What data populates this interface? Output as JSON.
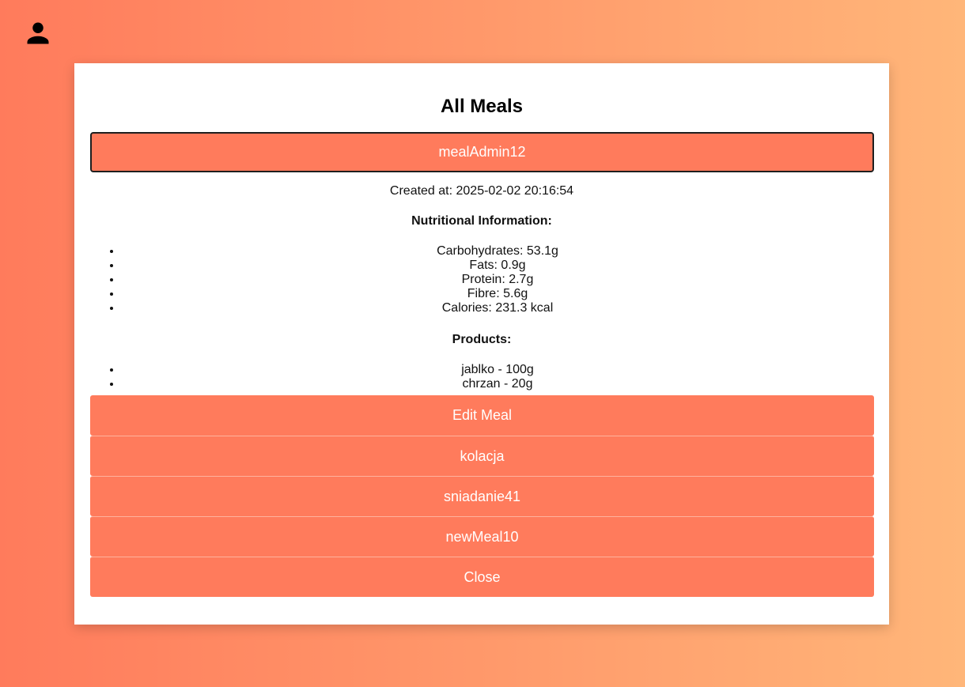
{
  "header": {
    "profile_icon": "user-icon"
  },
  "modal": {
    "title": "All Meals",
    "selected_meal": {
      "name": "mealAdmin12",
      "created_at": "Created at: 2025-02-02 20:16:54",
      "nutrition_heading": "Nutritional Information:",
      "nutrition": [
        "Carbohydrates: 53.1g",
        "Fats: 0.9g",
        "Protein: 2.7g",
        "Fibre: 5.6g",
        "Calories: 231.3 kcal"
      ],
      "products_heading": "Products:",
      "products": [
        "jablko - 100g",
        "chrzan - 20g"
      ],
      "edit_label": "Edit Meal"
    },
    "other_meals": [
      "kolacja",
      "sniadanie41",
      "newMeal10"
    ],
    "close_label": "Close"
  },
  "colors": {
    "accent": "#ff7b5c",
    "gradient_end": "#ffb679"
  }
}
